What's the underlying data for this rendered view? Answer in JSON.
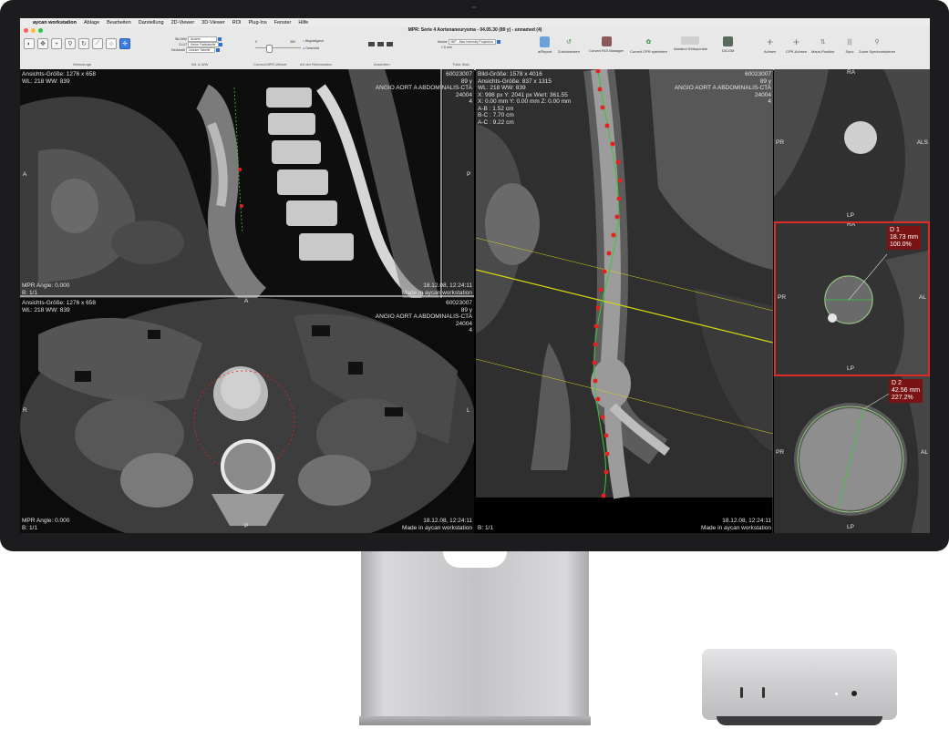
{
  "menubar": {
    "apple": "",
    "items": [
      "aycan workstation",
      "Ablage",
      "Bearbeiten",
      "Darstellung",
      "2D-Viewer",
      "3D-Viewer",
      "ROI",
      "Plug-Ins",
      "Fenster",
      "Hilfe"
    ]
  },
  "window": {
    "title": "MPR: Serie 4 Aortenaneurysma - 04.05.30 (89 y) - unnamed (4)",
    "traffic_light_colors": [
      "#ff5f57",
      "#febc2e",
      "#28c840"
    ]
  },
  "toolbar": {
    "group_labels": {
      "werkzeuge": "Werkzeuge",
      "wlww": "WL & WW",
      "curved_mpr": "Curved-MPR-Winkel",
      "reformation": "Art der Reformation",
      "ansichten": "Ansichten",
      "thick_slab": "Thick Slab"
    },
    "wlww_rows": [
      {
        "label": "WL/WW",
        "value": "Andere"
      },
      {
        "label": "CLUT",
        "value": "Keine Farbtabelle"
      },
      {
        "label": "Deckkraft",
        "value": "Lineare Tabelle"
      }
    ],
    "slider": {
      "min": "0",
      "max": "360"
    },
    "reformation_options": [
      "Begradigend",
      "Gestreckt"
    ],
    "thick_slab": {
      "modus_label": "Modus",
      "modus_value": "MIP - Max Intensity Projection",
      "thickness": "1.5 mm"
    },
    "buttons": [
      "a/Report",
      "Zurücksetzen",
      "Curved ROI Manager",
      "Curved CPR speichern",
      "Abstand Stützpunkte",
      "DICOM",
      "Achsen",
      "CPR-Achsen",
      "Maus-Position",
      "Sync",
      "Zoom Synchronisieren"
    ]
  },
  "viewports": {
    "sagittal": {
      "info_left": [
        "Ansichts-Größe: 1276 x 658",
        "WL: 218 WW: 839"
      ],
      "info_right": [
        "60023007",
        "89 y",
        "ANGIO AORT A ABDOMINALIS-CTA",
        "24004",
        "4"
      ],
      "orient_left": "A",
      "orient_right": "P",
      "footer_left": [
        "MPR Angle: 0.000",
        "B: 1/1"
      ],
      "footer_right": [
        "18.12.08, 12:24:11",
        "Made in aycan workstation"
      ]
    },
    "axial": {
      "info_left": [
        "Ansichts-Größe: 1276 x 658",
        "WL: 218 WW: 839"
      ],
      "info_right": [
        "60023007",
        "89 y",
        "ANGIO AORT A ABDOMINALIS-CTA",
        "24004",
        "4"
      ],
      "orient_top": "A",
      "orient_left": "R",
      "orient_right": "L",
      "orient_bottom": "P",
      "footer_left": [
        "MPR Angle: 0.000",
        "B: 1/1"
      ],
      "footer_right": [
        "18.12.08, 12:24:11",
        "Made in aycan workstation"
      ]
    },
    "curved": {
      "info_left": [
        "Bild-Größe: 1578 x 4016",
        "Ansichts-Größe: 837 x 1315",
        "WL: 218 WW: 839",
        "X: 998 px Y: 2041 px Wert: 361.55",
        "X: 0.00 mm Y: 0.00 mm Z: 0.00 mm",
        "A-B : 1.52 cm",
        "B-C : 7.70 cm",
        "A-C : 9.22 cm"
      ],
      "info_right": [
        "60023007",
        "89 y",
        "ANGIO AORT A ABDOMINALIS-CTA",
        "24004",
        "4"
      ],
      "footer_left": [
        "B: 1/1"
      ],
      "footer_right": [
        "18.12.08, 12:24:11",
        "Made in aycan workstation"
      ]
    },
    "cross_1": {
      "top": "RA",
      "left": "PR",
      "right": "ALS",
      "bottom": "LP"
    },
    "cross_2": {
      "top": "RA",
      "left": "PR",
      "right": "AL",
      "bottom": "LP",
      "measurement": {
        "name": "D 1",
        "value": "18.73 mm",
        "percent": "100.0%"
      }
    },
    "cross_3": {
      "left": "PR",
      "right": "AL",
      "bottom": "LP",
      "measurement": {
        "name": "D 2",
        "value": "42.56 mm",
        "percent": "227.2%"
      }
    }
  },
  "colors": {
    "centerline": "#36c83a",
    "control_point": "#e8201e",
    "plane_line": "#d8d810",
    "selected_border": "#e02a2a",
    "measure_bg": "#7a1414"
  }
}
